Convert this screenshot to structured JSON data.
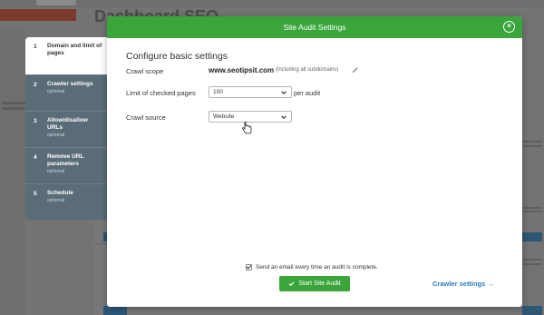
{
  "background": {
    "page_title": "Dashboard SEO"
  },
  "modal": {
    "title": "Site Audit Settings",
    "section_title": "Configure basic settings",
    "crawl_scope": {
      "label": "Crawl scope",
      "value": "www.seotipsit.com",
      "note": "(including all subdomains)"
    },
    "limit": {
      "label": "Limit of checked pages",
      "value": "100",
      "suffix": "per audit"
    },
    "crawl_source": {
      "label": "Crawl source",
      "value": "Website"
    },
    "email_label": "Send an email every time an audit is complete.",
    "email_checked": true,
    "start_button": "Start Site Audit",
    "crawler_link": "Crawler settings →"
  },
  "steps": [
    {
      "num": "1",
      "title": "Domain and limit of pages",
      "sub": ""
    },
    {
      "num": "2",
      "title": "Crawler settings",
      "sub": "optional"
    },
    {
      "num": "3",
      "title": "Allow/disallow URLs",
      "sub": "optional"
    },
    {
      "num": "4",
      "title": "Remove URL parameters",
      "sub": "optional"
    },
    {
      "num": "5",
      "title": "Schedule",
      "sub": "optional"
    }
  ],
  "colors": {
    "header_green": "#3aa53a",
    "link_blue": "#2a7bc0",
    "steps_bg": "#5a6c78"
  }
}
